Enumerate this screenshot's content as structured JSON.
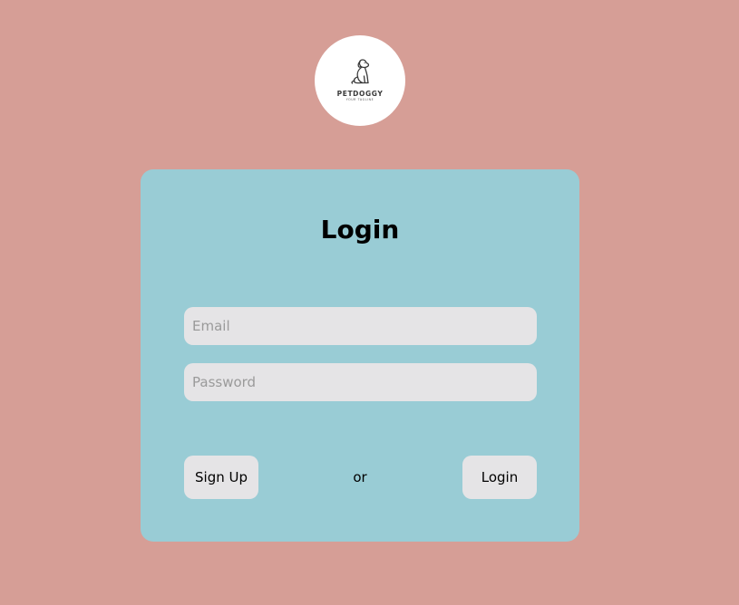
{
  "logo": {
    "brand_name": "PETDOGGY",
    "tagline": "YOUR TAGLINE"
  },
  "form": {
    "title": "Login",
    "email_placeholder": "Email",
    "password_placeholder": "Password",
    "email_value": "",
    "password_value": ""
  },
  "actions": {
    "signup_label": "Sign Up",
    "separator": "or",
    "login_label": "Login"
  },
  "colors": {
    "background": "#d69e96",
    "card": "#99ccd5",
    "input": "#e5e4e6",
    "button": "#e5e4e6"
  }
}
